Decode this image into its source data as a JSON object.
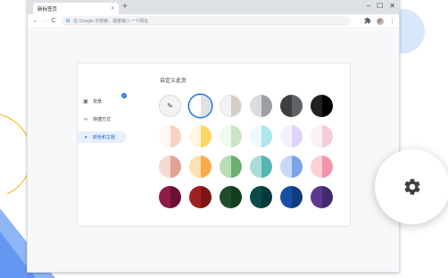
{
  "browser": {
    "tab_title": "新标签页",
    "tab_close": "×",
    "new_tab": "+",
    "win_min": "–",
    "win_max": "☐",
    "win_close": "✕",
    "back": "←",
    "forward": "→",
    "reload": "C",
    "omnibox_icon": "G",
    "omnibox_placeholder": "在 Google 中搜索，或者输入一个网址",
    "extensions_icon": "puzzle-icon",
    "menu_icon": "⋮"
  },
  "customize": {
    "title": "自定义此页",
    "sidebar": [
      {
        "label": "背景",
        "icon": "▣",
        "icon_name": "background-icon",
        "active": false
      },
      {
        "label": "快捷方式",
        "icon": "∞",
        "icon_name": "link-icon",
        "active": false
      },
      {
        "label": "颜色和主题",
        "icon": "◕",
        "icon_name": "palette-icon",
        "active": true
      }
    ],
    "selected_swatch_index": 1,
    "swatches": [
      {
        "left": "#ffffff",
        "right": "#ffffff",
        "custom": true
      },
      {
        "left": "#ffffff",
        "right": "#dfe1e5"
      },
      {
        "left": "#f1f3f4",
        "right": "#d7ccc8"
      },
      {
        "left": "#dadce0",
        "right": "#9aa0a6"
      },
      {
        "left": "#3c4043",
        "right": "#5f6368"
      },
      {
        "left": "#202124",
        "right": "#000000"
      },
      {
        "left": "#fef7f2",
        "right": "#fad2c1"
      },
      {
        "left": "#fef7e0",
        "right": "#fdd663"
      },
      {
        "left": "#f1f8ef",
        "right": "#c9e4c6"
      },
      {
        "left": "#eef9fb",
        "right": "#aee5ee"
      },
      {
        "left": "#f6f0fd",
        "right": "#e2d2f9"
      },
      {
        "left": "#fbf0f3",
        "right": "#f3cdd8"
      },
      {
        "left": "#f7d9cf",
        "right": "#e0a393"
      },
      {
        "left": "#fde1b1",
        "right": "#f9ab4b"
      },
      {
        "left": "#b7deb3",
        "right": "#6eaf75"
      },
      {
        "left": "#a9dcd9",
        "right": "#57b5b0"
      },
      {
        "left": "#c7d7f7",
        "right": "#7ba3ea"
      },
      {
        "left": "#fbd0d9",
        "right": "#f494ab"
      },
      {
        "left": "#8e1c48",
        "right": "#6b1234"
      },
      {
        "left": "#a11f1f",
        "right": "#7e1515"
      },
      {
        "left": "#1e4d2b",
        "right": "#123d1f"
      },
      {
        "left": "#0b4c4a",
        "right": "#08393a"
      },
      {
        "left": "#174ea6",
        "right": "#123b7e"
      },
      {
        "left": "#5b3a8e",
        "right": "#442a6c"
      }
    ]
  },
  "fab": {
    "icon": "gear-icon"
  }
}
